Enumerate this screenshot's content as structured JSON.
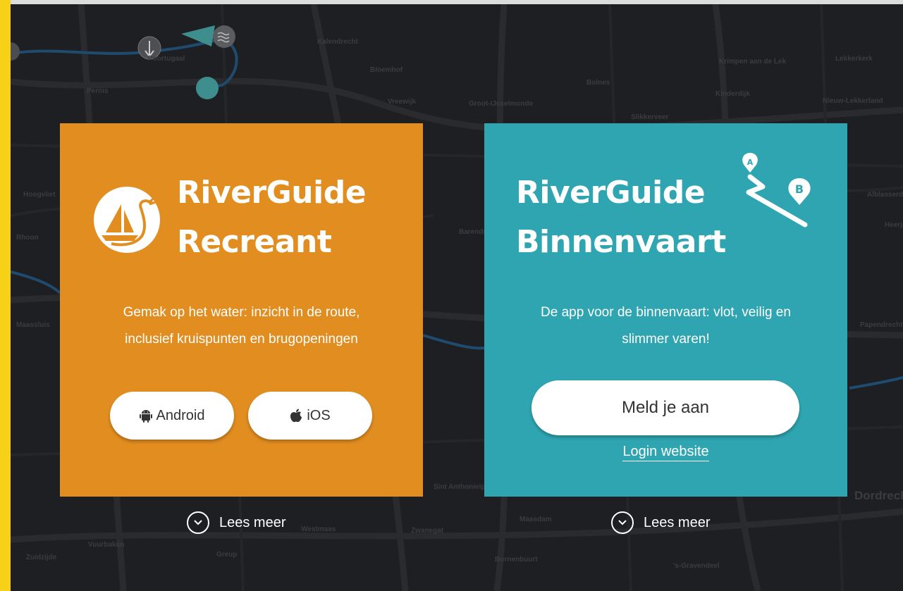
{
  "map": {
    "labels": [
      "Kalendrecht",
      "Bloemhof",
      "Vreewijk",
      "Groot-IJsselmonde",
      "Bolnes",
      "Krimpen aan de Lek",
      "Lekkerkerk",
      "Nieuw-Lekkerland",
      "Kinderdijk",
      "Slikkerveer",
      "Pernis",
      "Hoogvliet",
      "Maassluis",
      "Westmaas",
      "Zuidzijde",
      "Vuurbaken",
      "Greup",
      "Sint Anthonielpolder",
      "Zwanegat",
      "Maasdam",
      "Bornenbuurt",
      "'s-Gravendeel",
      "Papendrecht",
      "Dordrecht",
      "Alblasserdam",
      "Barendrecht",
      "Heerjansdam",
      "Rhoon",
      "Poortugaal"
    ]
  },
  "recreant": {
    "title_line1": "RiverGuide",
    "title_line2": "Recreant",
    "description_line1": "Gemak op het water: inzicht in de route,",
    "description_line2": "inclusief kruispunten en brugopeningen",
    "android_label": "Android",
    "ios_label": "iOS",
    "read_more": "Lees meer",
    "color": "#e18d20"
  },
  "binnenvaart": {
    "title_line1": "RiverGuide",
    "title_line2": "Binnenvaart",
    "description_line1": "De app voor de binnenvaart: vlot, veilig en",
    "description_line2": "slimmer varen!",
    "signup_label": "Meld je aan",
    "login_label": "Login website",
    "read_more": "Lees meer",
    "marker_a": "A",
    "marker_b": "B",
    "color": "#2ea5b0"
  }
}
